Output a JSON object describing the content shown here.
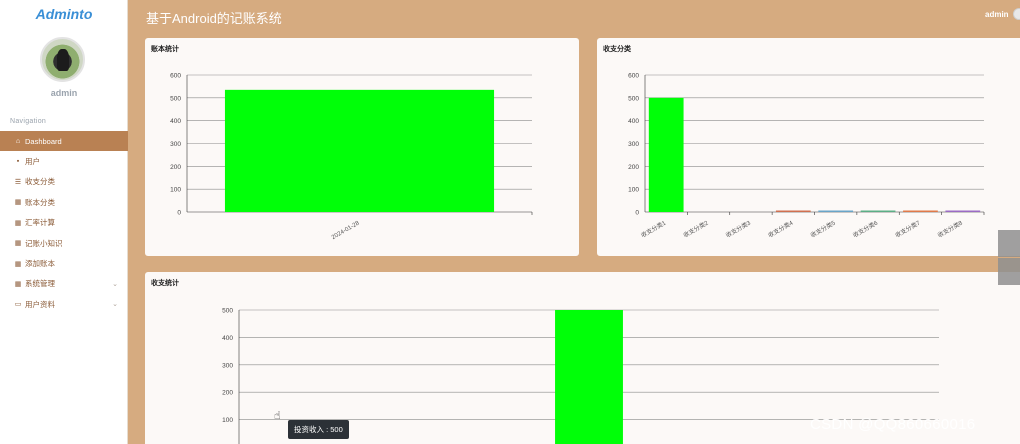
{
  "app": {
    "brand": "Adminto",
    "title": "基于Android的记账系统",
    "user": "admin"
  },
  "sidebar": {
    "username": "admin",
    "nav_title": "Navigation",
    "items": [
      {
        "label": "Dashboard",
        "icon": "home-icon",
        "glyph": "⌂",
        "active": true
      },
      {
        "label": "用户",
        "icon": "chat-icon",
        "glyph": "▪"
      },
      {
        "label": "收支分类",
        "icon": "list-icon",
        "glyph": "☰"
      },
      {
        "label": "账本分类",
        "icon": "grid-icon",
        "glyph": "▦"
      },
      {
        "label": "汇率计算",
        "icon": "grid-icon",
        "glyph": "▦"
      },
      {
        "label": "记账小知识",
        "icon": "grid-icon",
        "glyph": "▦"
      },
      {
        "label": "添加账本",
        "icon": "grid-icon",
        "glyph": "▦"
      },
      {
        "label": "系统管理",
        "icon": "grid-icon",
        "glyph": "▦",
        "expandable": true
      },
      {
        "label": "用户资料",
        "icon": "card-icon",
        "glyph": "▭",
        "expandable": true
      }
    ]
  },
  "colors": {
    "accent": "#b98153",
    "background": "#d6ab80",
    "bar": "#00ff08"
  },
  "chart_data": [
    {
      "type": "bar",
      "title": "账本统计",
      "categories": [
        "2024-01-28"
      ],
      "values": [
        535
      ],
      "ylim": [
        0,
        600
      ],
      "yticks": [
        0,
        100,
        200,
        300,
        400,
        500,
        600
      ],
      "grid": true
    },
    {
      "type": "bar",
      "title": "收支分类",
      "categories": [
        "收支分类1",
        "收支分类2",
        "收支分类3",
        "收支分类4",
        "收支分类5",
        "收支分类6",
        "收支分类7",
        "收支分类8"
      ],
      "values": [
        500,
        0,
        0,
        2,
        3,
        4,
        5,
        6
      ],
      "colors": [
        "#00ff08",
        "#5b5b5b",
        "#c8a060",
        "#d07050",
        "#6aa5c8",
        "#5cae86",
        "#e07a4a",
        "#9b6cc4"
      ],
      "ylim": [
        0,
        600
      ],
      "yticks": [
        0,
        100,
        200,
        300,
        400,
        500,
        600
      ],
      "grid": true
    },
    {
      "type": "bar",
      "title": "收支统计",
      "categories": [
        "投资收入"
      ],
      "values": [
        500
      ],
      "ylim": [
        0,
        500
      ],
      "yticks": [
        100,
        200,
        300,
        400,
        500
      ],
      "grid": true,
      "tooltip": "投资收入 : 500"
    }
  ],
  "watermark": "CSDN @QQ860660016"
}
